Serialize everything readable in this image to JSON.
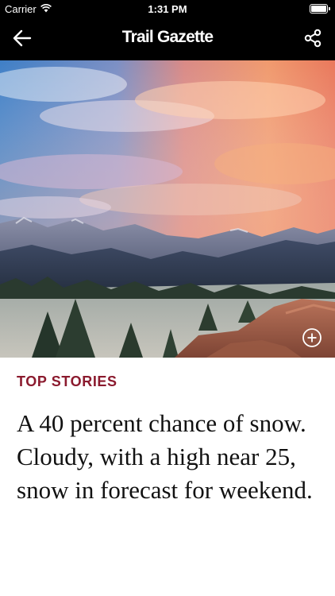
{
  "status_bar": {
    "carrier": "Carrier",
    "time": "1:31 PM"
  },
  "nav": {
    "title": "Trail Gazette",
    "back_icon": "arrow-left-icon",
    "share_icon": "share-icon"
  },
  "hero": {
    "expand_icon": "plus-circle-icon"
  },
  "article": {
    "section": "TOP STORIES",
    "headline": "A 40 percent chance of snow. Cloudy, with a high near 25, snow in forecast for weekend."
  },
  "colors": {
    "nav_background": "#000000",
    "section_accent": "#8b1a2e",
    "headline_text": "#111111"
  }
}
